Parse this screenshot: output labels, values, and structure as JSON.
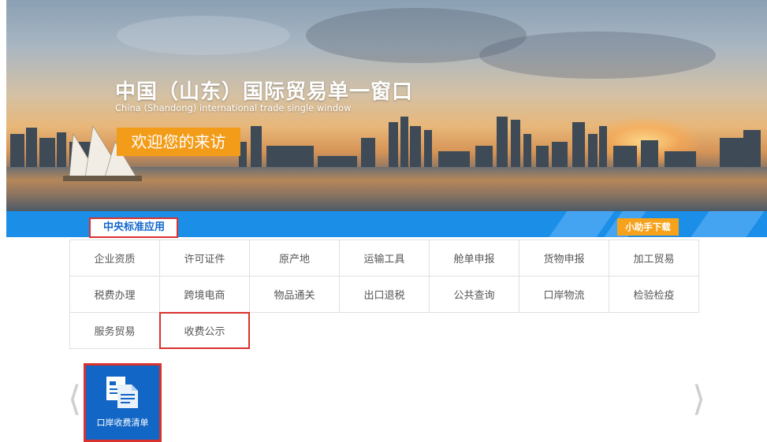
{
  "banner": {
    "title_cn": "中国（山东）国际贸易单一窗口",
    "title_en": "China (Shandong) international trade single window",
    "welcome": "欢迎您的来访"
  },
  "nav": {
    "active_tab": "中央标准应用",
    "download_button": "小助手下载"
  },
  "grid": {
    "rows": [
      [
        "企业资质",
        "许可证件",
        "原产地",
        "运输工具",
        "舱单申报",
        "货物申报",
        "加工贸易"
      ],
      [
        "税费办理",
        "跨境电商",
        "物品通关",
        "出口退税",
        "公共查询",
        "口岸物流",
        "检验检疫"
      ],
      [
        "服务贸易",
        "收费公示"
      ]
    ],
    "selected": "收费公示"
  },
  "carousel": {
    "items": [
      {
        "label": "口岸收费清单",
        "icon": "document-list-icon"
      }
    ],
    "prev_icon": "chevron-left-icon",
    "next_icon": "chevron-right-icon"
  },
  "colors": {
    "accent_blue": "#1b8ee8",
    "tile_blue": "#1266c5",
    "orange": "#f39c1a",
    "highlight_red": "#d9312e"
  }
}
